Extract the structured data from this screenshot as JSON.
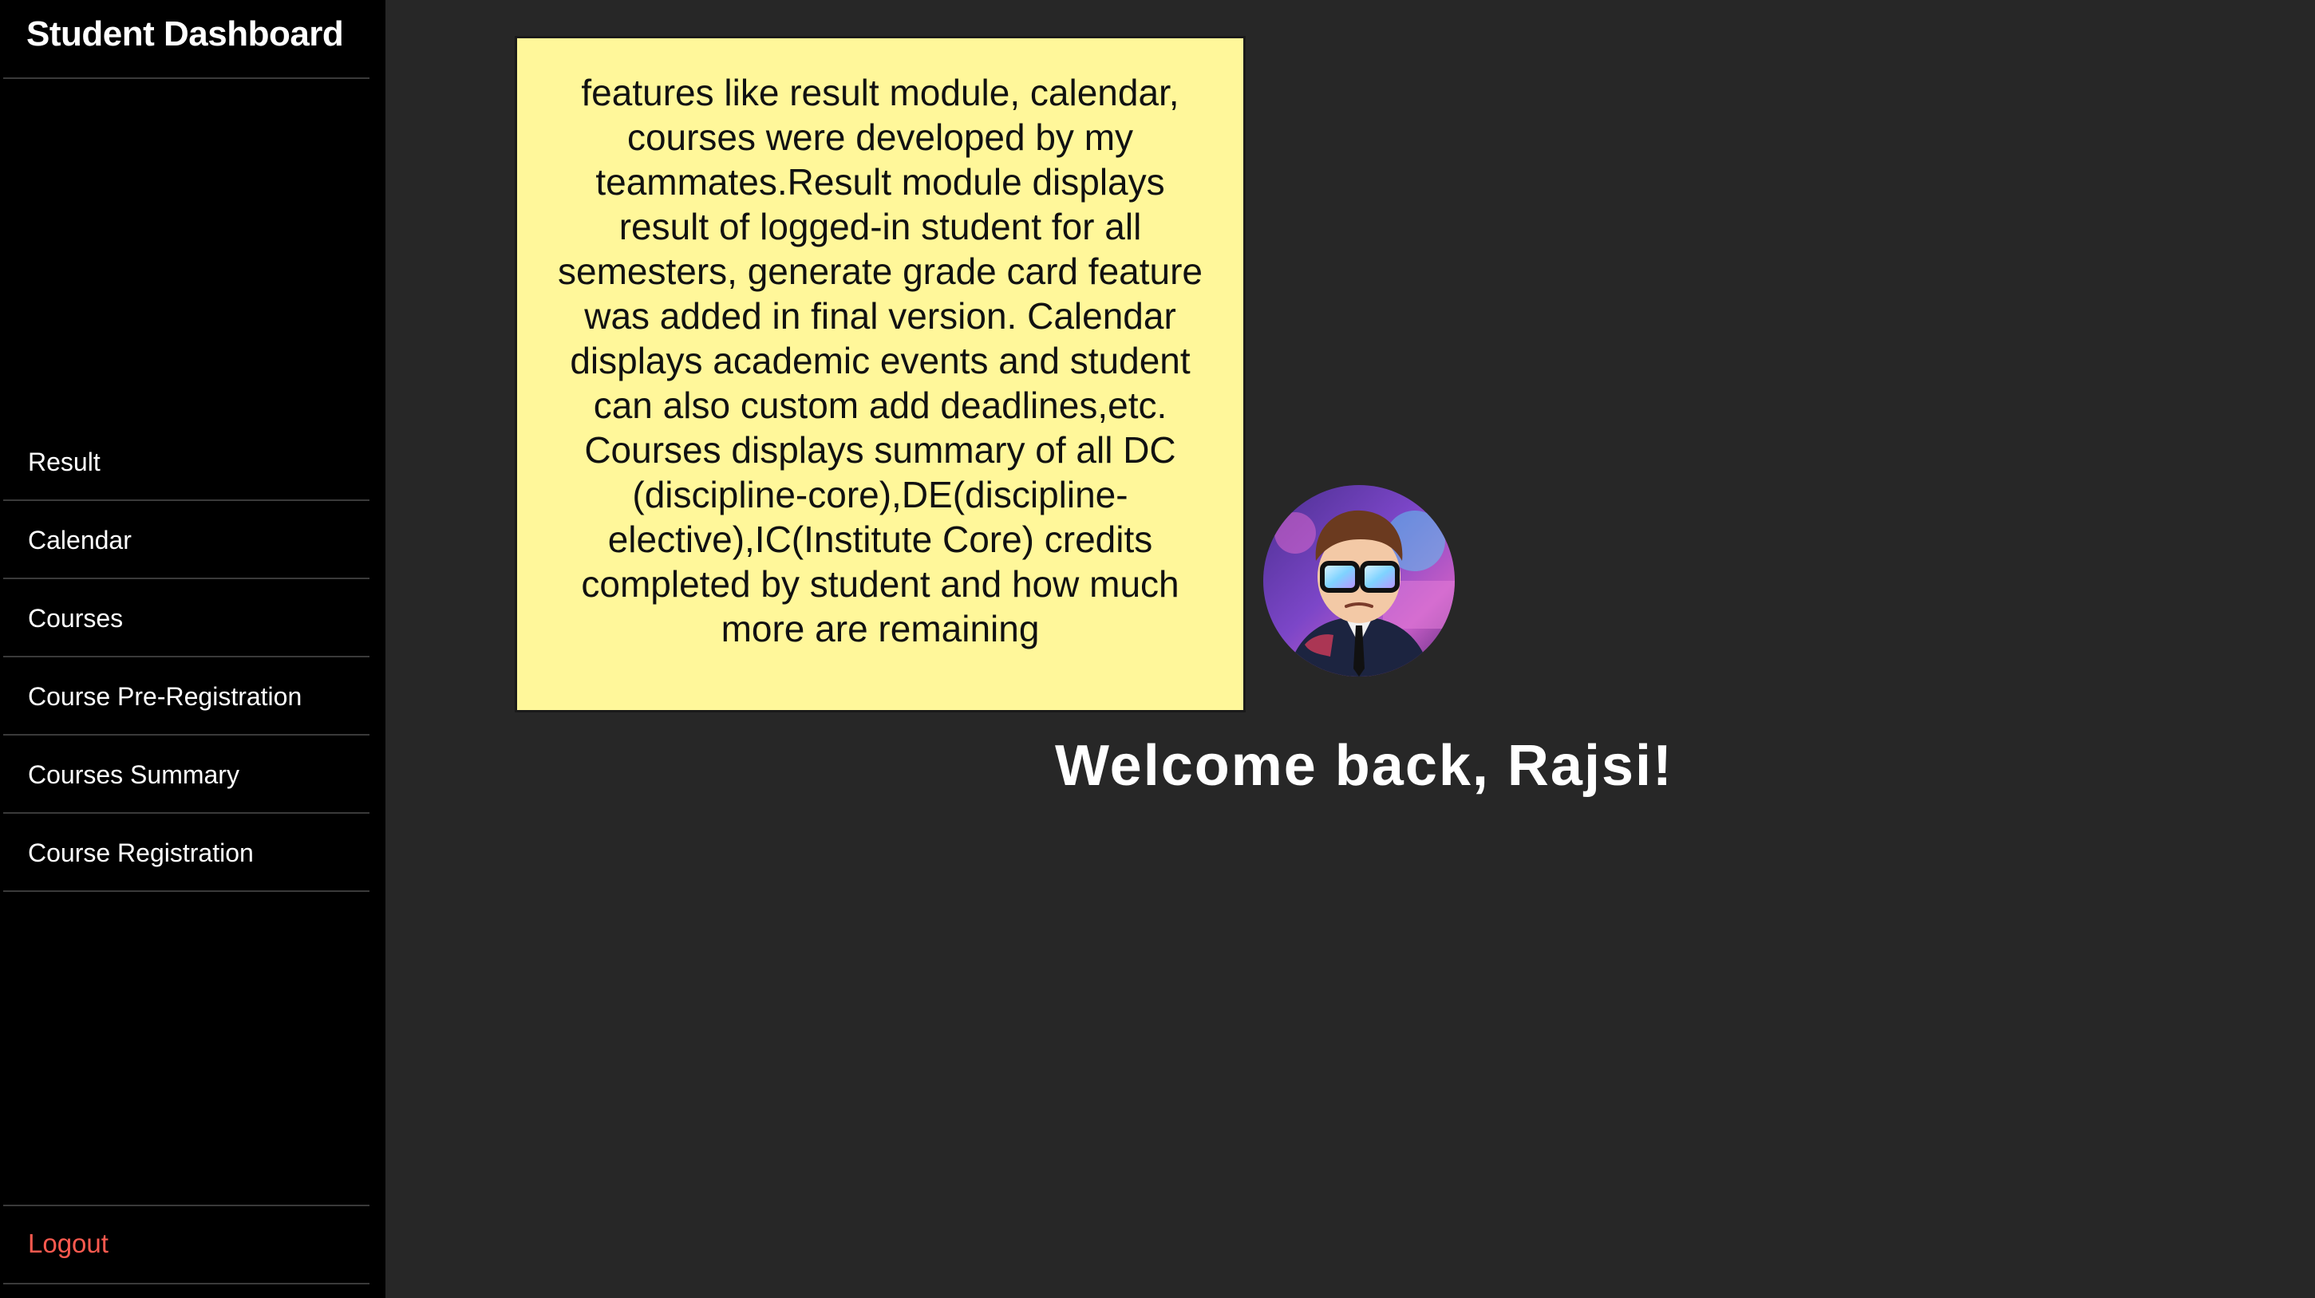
{
  "sidebar": {
    "title": "Student Dashboard",
    "items": [
      {
        "label": "Result"
      },
      {
        "label": "Calendar"
      },
      {
        "label": "Courses"
      },
      {
        "label": "Course Pre-Registration"
      },
      {
        "label": "Courses Summary"
      },
      {
        "label": "Course Registration"
      }
    ],
    "logout_label": "Logout"
  },
  "note": {
    "text": "features like result module, calendar, courses were developed by my teammates.Result module displays result of logged-in student for all semesters, generate grade card feature was added in final version. Calendar displays academic events and student can also custom add deadlines,etc. Courses displays summary of all DC (discipline-core),DE(discipline-elective),IC(Institute Core) credits completed by student and how much more are remaining"
  },
  "welcome": {
    "text": "Welcome back, Rajsi!"
  },
  "colors": {
    "sidebar_bg": "#000000",
    "main_bg": "#272727",
    "note_bg": "#fff79a",
    "logout": "#ff5a4f"
  }
}
